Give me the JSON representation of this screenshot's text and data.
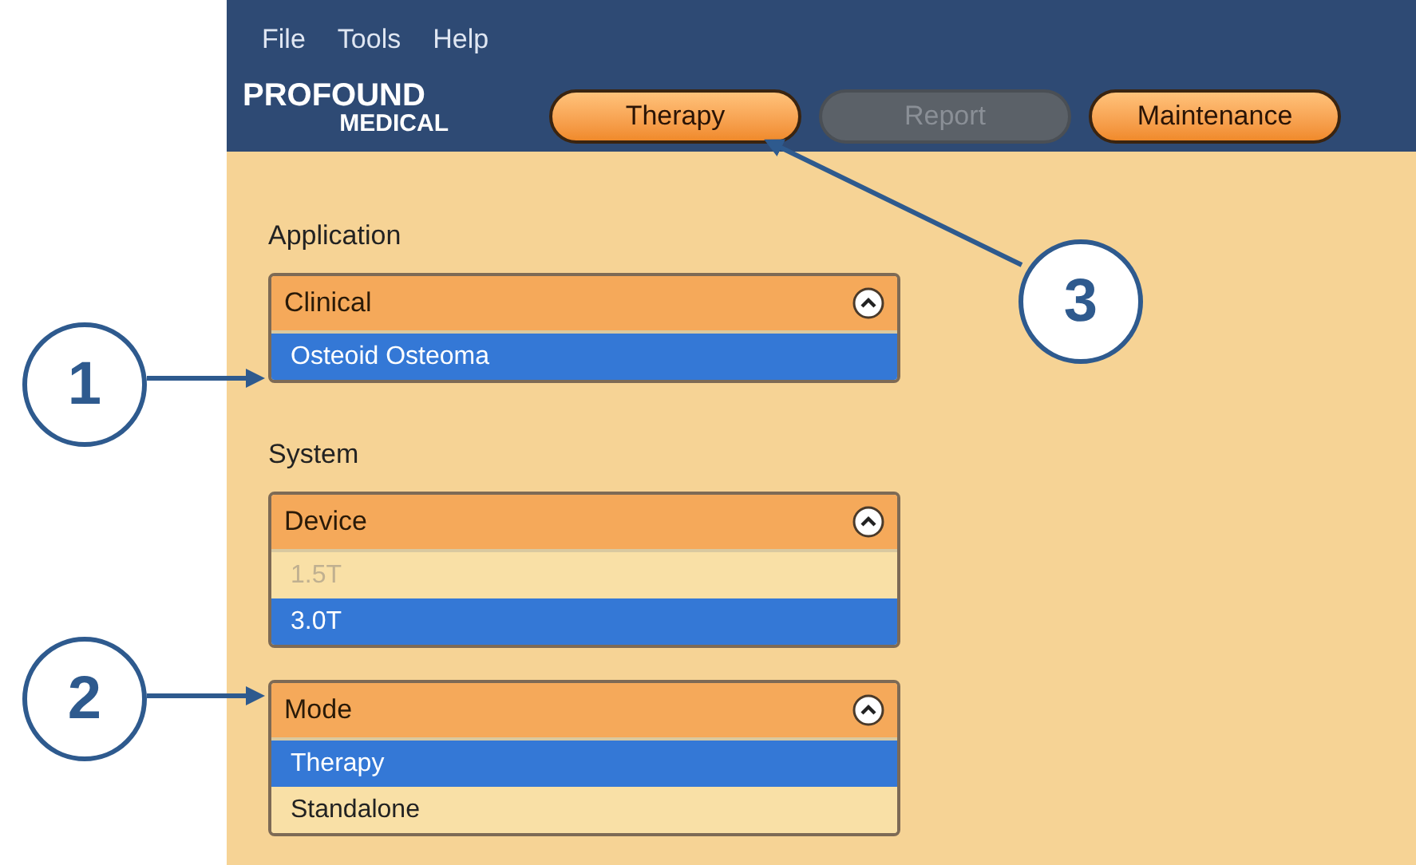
{
  "menu": [
    "File",
    "Tools",
    "Help"
  ],
  "logo": {
    "line1": "PROFOUND",
    "line2": "MEDICAL"
  },
  "tabs": [
    {
      "label": "Therapy",
      "disabled": false
    },
    {
      "label": "Report",
      "disabled": true
    },
    {
      "label": "Maintenance",
      "disabled": false
    }
  ],
  "sections": [
    {
      "title": "Application",
      "panels": [
        {
          "title": "Clinical",
          "items": [
            {
              "label": "Osteoid Osteoma",
              "selected": true,
              "disabled": false
            }
          ]
        }
      ]
    },
    {
      "title": "System",
      "panels": [
        {
          "title": "Device",
          "items": [
            {
              "label": "1.5T",
              "selected": false,
              "disabled": true
            },
            {
              "label": "3.0T",
              "selected": true,
              "disabled": false
            }
          ]
        },
        {
          "title": "Mode",
          "items": [
            {
              "label": "Therapy",
              "selected": true,
              "disabled": false
            },
            {
              "label": "Standalone",
              "selected": false,
              "disabled": false
            }
          ]
        }
      ]
    }
  ],
  "callouts": [
    {
      "number": "1"
    },
    {
      "number": "2"
    },
    {
      "number": "3"
    }
  ]
}
